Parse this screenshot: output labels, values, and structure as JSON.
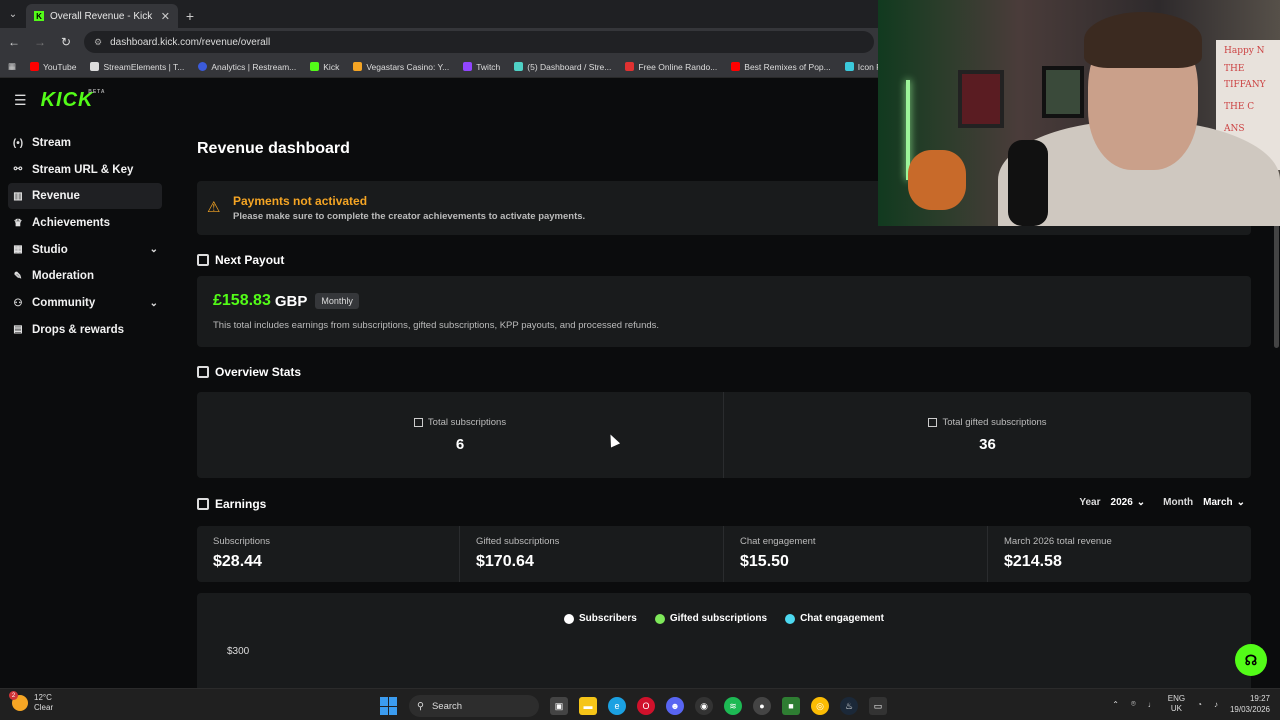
{
  "browser": {
    "tab_title": "Overall Revenue - Kick Dashbo",
    "tab_favicon": "K",
    "url": "dashboard.kick.com/revenue/overall",
    "bookmarks": [
      {
        "label": "YouTube",
        "color": "#ff0000"
      },
      {
        "label": "StreamElements | T...",
        "color": "#dddddd"
      },
      {
        "label": "Analytics | Restream...",
        "color": "#3b5bdb"
      },
      {
        "label": "Kick",
        "color": "#53fc18"
      },
      {
        "label": "Vegastars Casino: Y...",
        "color": "#f5a524"
      },
      {
        "label": "Twitch",
        "color": "#9146ff"
      },
      {
        "label": "(5) Dashboard / Stre...",
        "color": "#4fd1c5"
      },
      {
        "label": "Free Online Rando...",
        "color": "#e03131"
      },
      {
        "label": "Best Remixes of Pop...",
        "color": "#ff0000"
      },
      {
        "label": "Icon Roulette Whe",
        "color": "#3bc9db"
      }
    ]
  },
  "app": {
    "logo": "KICK",
    "logo_badge": "BETA",
    "accent": "#53fc18"
  },
  "sidebar": {
    "items": [
      {
        "label": "Stream",
        "icon": "(•)"
      },
      {
        "label": "Stream URL & Key",
        "icon": "⚲"
      },
      {
        "label": "Revenue",
        "icon": "▥"
      },
      {
        "label": "Achievements",
        "icon": "🏆"
      },
      {
        "label": "Studio",
        "icon": "▦"
      },
      {
        "label": "Moderation",
        "icon": "✎"
      },
      {
        "label": "Community",
        "icon": "👥"
      },
      {
        "label": "Drops & rewards",
        "icon": "▤"
      }
    ]
  },
  "main": {
    "title": "Revenue dashboard",
    "warning": {
      "title": "Payments not activated",
      "text": "Please make sure to complete the creator achievements to activate payments."
    },
    "next_payout": {
      "heading": "Next Payout",
      "amount": "£158.83",
      "currency": "GBP",
      "badge": "Monthly",
      "note": "This total includes earnings from subscriptions, gifted subscriptions, KPP payouts, and processed refunds."
    },
    "overview": {
      "heading": "Overview Stats",
      "stats": [
        {
          "label": "Total subscriptions",
          "value": "6"
        },
        {
          "label": "Total gifted subscriptions",
          "value": "36"
        }
      ]
    },
    "earnings": {
      "heading": "Earnings",
      "year_label": "Year",
      "year_value": "2026",
      "month_label": "Month",
      "month_value": "March",
      "cards": [
        {
          "label": "Subscriptions",
          "value": "$28.44"
        },
        {
          "label": "Gifted subscriptions",
          "value": "$170.64"
        },
        {
          "label": "Chat engagement",
          "value": "$15.50"
        },
        {
          "label": "March 2026 total revenue",
          "value": "$214.58"
        }
      ],
      "legend": [
        {
          "label": "Subscribers",
          "color": "#ffffff"
        },
        {
          "label": "Gifted subscriptions",
          "color": "#7ee85a"
        },
        {
          "label": "Chat engagement",
          "color": "#4dd9f0"
        }
      ],
      "y_tick": "$300"
    }
  },
  "webcam": {
    "board_lines": [
      "Happy N",
      "THE",
      "TIFFANY",
      "THE C",
      "ANS"
    ]
  },
  "taskbar": {
    "temp": "12°C",
    "condition": "Clear",
    "notif_count": "2",
    "search_placeholder": "Search",
    "lang_top": "ENG",
    "lang_bottom": "UK",
    "time": "19:27",
    "date": "19/03/2026"
  }
}
